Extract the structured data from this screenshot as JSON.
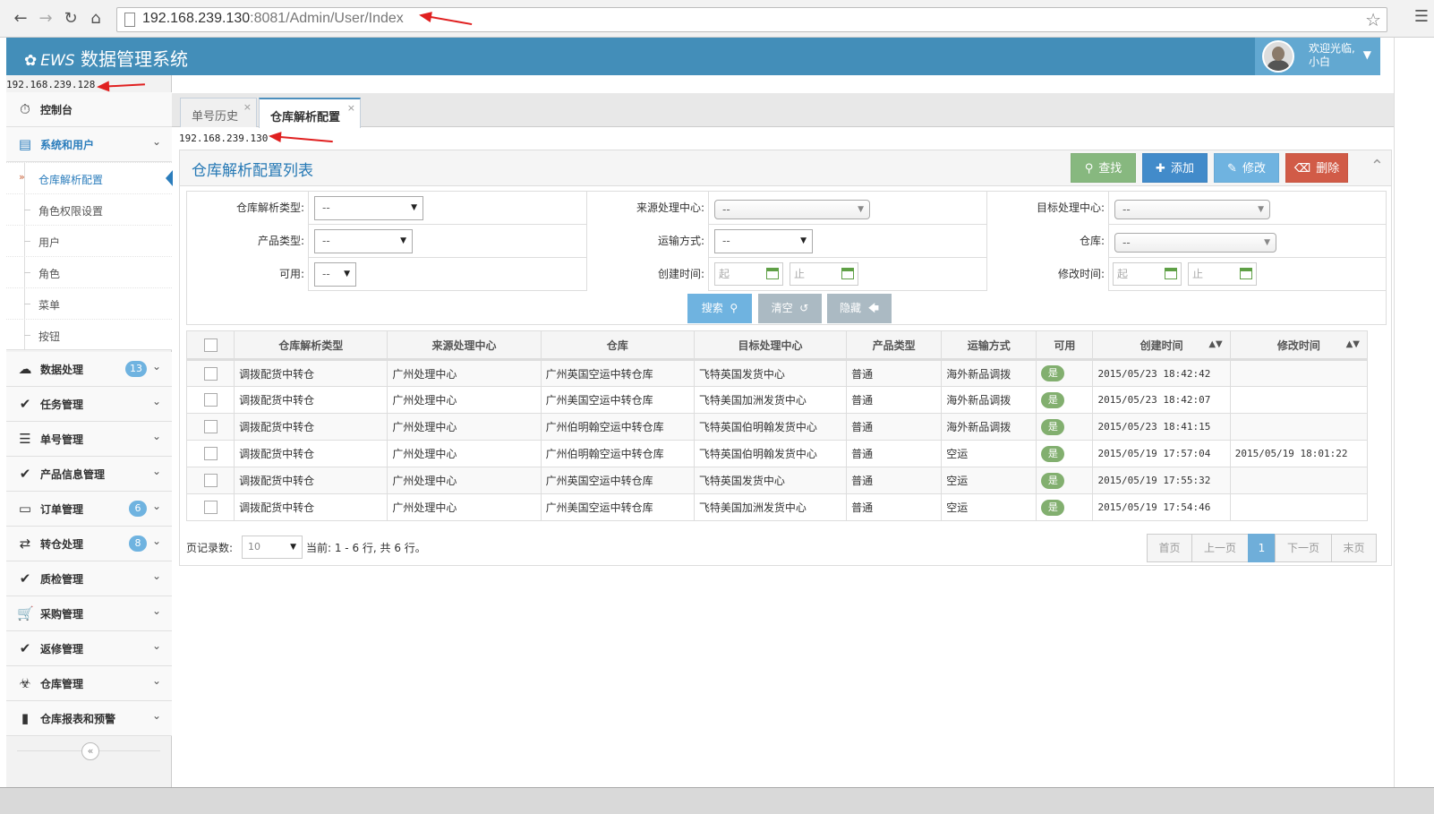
{
  "browser": {
    "url_host": "192.168.239.130",
    "url_rest": ":8081/Admin/User/Index"
  },
  "app": {
    "logo_text": "EWS",
    "title": "数据管理系统",
    "welcome_line1": "欢迎光临,",
    "welcome_line2": "小白"
  },
  "sidebar": {
    "ip": "192.168.239.128",
    "items": [
      {
        "label": "控制台",
        "icon": "dashboard-icon"
      },
      {
        "label": "系统和用户",
        "icon": "desktop-icon"
      },
      {
        "label": "数据处理",
        "icon": "cloud-upload-icon",
        "badge": "13"
      },
      {
        "label": "任务管理",
        "icon": "check-circle-icon"
      },
      {
        "label": "单号管理",
        "icon": "list-icon"
      },
      {
        "label": "产品信息管理",
        "icon": "check-circle-icon"
      },
      {
        "label": "订单管理",
        "icon": "credit-card-icon",
        "badge": "6"
      },
      {
        "label": "转仓处理",
        "icon": "exchange-icon",
        "badge": "8"
      },
      {
        "label": "质检管理",
        "icon": "check-circle-icon"
      },
      {
        "label": "采购管理",
        "icon": "shopping-cart-icon"
      },
      {
        "label": "返修管理",
        "icon": "check-circle-icon"
      },
      {
        "label": "仓库管理",
        "icon": "warehouse-icon"
      },
      {
        "label": "仓库报表和预警",
        "icon": "book-icon"
      }
    ],
    "submenu": [
      "仓库解析配置",
      "角色权限设置",
      "用户",
      "角色",
      "菜单",
      "按钮"
    ],
    "collapse_label": "«"
  },
  "tabs": [
    {
      "label": "单号历史",
      "close": "×"
    },
    {
      "label": "仓库解析配置",
      "close": "×"
    }
  ],
  "main_ip": "192.168.239.130",
  "panel": {
    "title": "仓库解析配置列表",
    "buttons": {
      "find": "查找",
      "add": "添加",
      "edit": "修改",
      "delete": "删除"
    },
    "colors": {
      "find": "#87b87f",
      "add": "#428bca",
      "edit": "#6fb3e0",
      "delete": "#d15b47"
    }
  },
  "filter": {
    "labels": {
      "type": "仓库解析类型:",
      "source": "来源处理中心:",
      "target": "目标处理中心:",
      "product": "产品类型:",
      "transport": "运输方式:",
      "warehouse": "仓库:",
      "enabled": "可用:",
      "created": "创建时间:",
      "modified": "修改时间:"
    },
    "select_value": "--",
    "date_from": "起",
    "date_to": "止",
    "search_btn": "搜索",
    "clear_btn": "清空",
    "hide_btn": "隐藏"
  },
  "table": {
    "headers": [
      "仓库解析类型",
      "来源处理中心",
      "仓库",
      "目标处理中心",
      "产品类型",
      "运输方式",
      "可用",
      "创建时间",
      "修改时间"
    ],
    "rows": [
      [
        "调拨配货中转仓",
        "广州处理中心",
        "广州英国空运中转仓库",
        "飞特英国发货中心",
        "普通",
        "海外新品调拨",
        "是",
        "2015/05/23 18:42:42",
        ""
      ],
      [
        "调拨配货中转仓",
        "广州处理中心",
        "广州美国空运中转仓库",
        "飞特美国加洲发货中心",
        "普通",
        "海外新品调拨",
        "是",
        "2015/05/23 18:42:07",
        ""
      ],
      [
        "调拨配货中转仓",
        "广州处理中心",
        "广州伯明翰空运中转仓库",
        "飞特英国伯明翰发货中心",
        "普通",
        "海外新品调拨",
        "是",
        "2015/05/23 18:41:15",
        ""
      ],
      [
        "调拨配货中转仓",
        "广州处理中心",
        "广州伯明翰空运中转仓库",
        "飞特英国伯明翰发货中心",
        "普通",
        "空运",
        "是",
        "2015/05/19 17:57:04",
        "2015/05/19 18:01:22"
      ],
      [
        "调拨配货中转仓",
        "广州处理中心",
        "广州英国空运中转仓库",
        "飞特英国发货中心",
        "普通",
        "空运",
        "是",
        "2015/05/19 17:55:32",
        ""
      ],
      [
        "调拨配货中转仓",
        "广州处理中心",
        "广州美国空运中转仓库",
        "飞特美国加洲发货中心",
        "普通",
        "空运",
        "是",
        "2015/05/19 17:54:46",
        ""
      ]
    ]
  },
  "pager": {
    "page_size_label": "页记录数:",
    "page_size": "10",
    "info": "当前: 1 - 6 行, 共 6 行。",
    "first": "首页",
    "prev": "上一页",
    "current": "1",
    "next": "下一页",
    "last": "末页"
  }
}
